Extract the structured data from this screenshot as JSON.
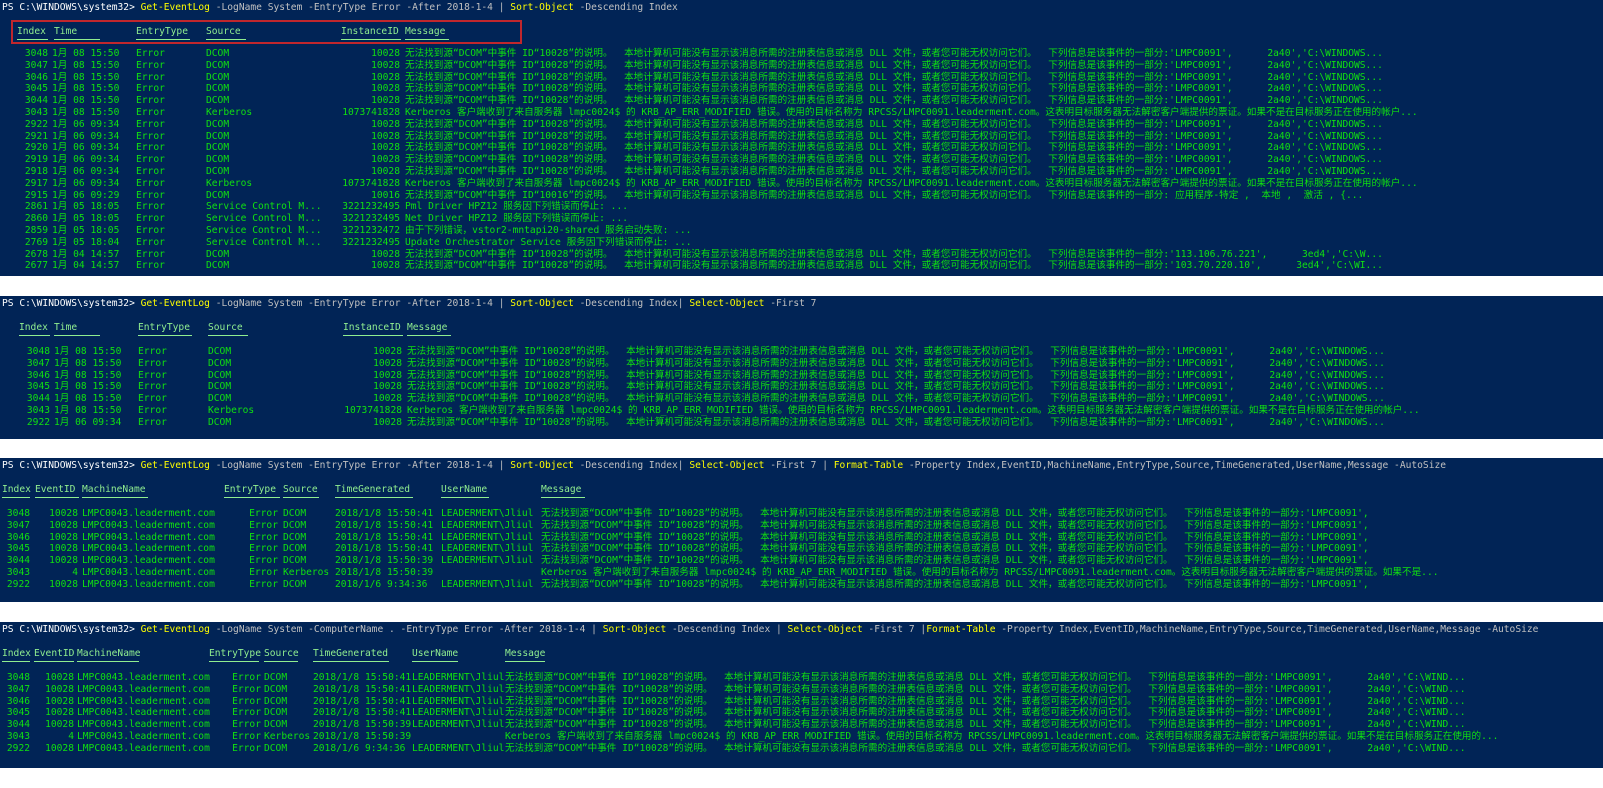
{
  "colors": {
    "background": "#012456",
    "prompt": "#ffffff",
    "cmdlet": "#ffff00",
    "parameter": "#c0c0c0",
    "output": "#10e010",
    "highlight": "#c0272d"
  },
  "panels": [
    {
      "command": [
        {
          "t": "PS C:\\WINDOWS\\system32> ",
          "c": "prompt"
        },
        {
          "t": "Get-EventLog",
          "c": "kw"
        },
        {
          "t": " -LogName System -EntryType Error -After 2018-1-4 | ",
          "c": "param"
        },
        {
          "t": "Sort-Object",
          "c": "kw"
        },
        {
          "t": " -Descending Index",
          "c": "param"
        }
      ],
      "headers": [
        "Index",
        "Time",
        "EntryType",
        "Source",
        "InstanceID",
        "Message"
      ],
      "rows": [
        [
          "3048",
          "1月 08 15:50",
          "Error",
          "DCOM",
          "10028",
          "无法找到源“DCOM”中事件 ID“10028”的说明。  本地计算机可能没有显示该消息所需的注册表信息或消息 DLL 文件，或者您可能无权访问它们。  下列信息是该事件的一部分:'LMPC0091',      2a40','C:\\WINDOWS..."
        ],
        [
          "3047",
          "1月 08 15:50",
          "Error",
          "DCOM",
          "10028",
          "无法找到源“DCOM”中事件 ID“10028”的说明。  本地计算机可能没有显示该消息所需的注册表信息或消息 DLL 文件，或者您可能无权访问它们。  下列信息是该事件的一部分:'LMPC0091',      2a40','C:\\WINDOWS..."
        ],
        [
          "3046",
          "1月 08 15:50",
          "Error",
          "DCOM",
          "10028",
          "无法找到源“DCOM”中事件 ID“10028”的说明。  本地计算机可能没有显示该消息所需的注册表信息或消息 DLL 文件，或者您可能无权访问它们。  下列信息是该事件的一部分:'LMPC0091',      2a40','C:\\WINDOWS..."
        ],
        [
          "3045",
          "1月 08 15:50",
          "Error",
          "DCOM",
          "10028",
          "无法找到源“DCOM”中事件 ID“10028”的说明。  本地计算机可能没有显示该消息所需的注册表信息或消息 DLL 文件，或者您可能无权访问它们。  下列信息是该事件的一部分:'LMPC0091',      2a40','C:\\WINDOWS..."
        ],
        [
          "3044",
          "1月 08 15:50",
          "Error",
          "DCOM",
          "10028",
          "无法找到源“DCOM”中事件 ID“10028”的说明。  本地计算机可能没有显示该消息所需的注册表信息或消息 DLL 文件，或者您可能无权访问它们。  下列信息是该事件的一部分:'LMPC0091',      2a40','C:\\WINDOWS..."
        ],
        [
          "3043",
          "1月 08 15:50",
          "Error",
          "Kerberos",
          "1073741828",
          "Kerberos 客户端收到了来自服务器 lmpc0024$ 的 KRB_AP_ERR_MODIFIED 错误。使用的目标名称为 RPCSS/LMPC0091.leaderment.com。这表明目标服务器无法解密客户端提供的票证。如果不是在目标服务正在使用的帐户..."
        ],
        [
          "2922",
          "1月 06 09:34",
          "Error",
          "DCOM",
          "10028",
          "无法找到源“DCOM”中事件 ID“10028”的说明。  本地计算机可能没有显示该消息所需的注册表信息或消息 DLL 文件，或者您可能无权访问它们。  下列信息是该事件的一部分:'LMPC0091',      2a40','C:\\WINDOWS..."
        ],
        [
          "2921",
          "1月 06 09:34",
          "Error",
          "DCOM",
          "10028",
          "无法找到源“DCOM”中事件 ID“10028”的说明。  本地计算机可能没有显示该消息所需的注册表信息或消息 DLL 文件，或者您可能无权访问它们。  下列信息是该事件的一部分:'LMPC0091',      2a40','C:\\WINDOWS..."
        ],
        [
          "2920",
          "1月 06 09:34",
          "Error",
          "DCOM",
          "10028",
          "无法找到源“DCOM”中事件 ID“10028”的说明。  本地计算机可能没有显示该消息所需的注册表信息或消息 DLL 文件，或者您可能无权访问它们。  下列信息是该事件的一部分:'LMPC0091',      2a40','C:\\WINDOWS..."
        ],
        [
          "2919",
          "1月 06 09:34",
          "Error",
          "DCOM",
          "10028",
          "无法找到源“DCOM”中事件 ID“10028”的说明。  本地计算机可能没有显示该消息所需的注册表信息或消息 DLL 文件，或者您可能无权访问它们。  下列信息是该事件的一部分:'LMPC0091',      2a40','C:\\WINDOWS..."
        ],
        [
          "2918",
          "1月 06 09:34",
          "Error",
          "DCOM",
          "10028",
          "无法找到源“DCOM”中事件 ID“10028”的说明。  本地计算机可能没有显示该消息所需的注册表信息或消息 DLL 文件，或者您可能无权访问它们。  下列信息是该事件的一部分:'LMPC0091',      2a40','C:\\WINDOWS..."
        ],
        [
          "2917",
          "1月 06 09:34",
          "Error",
          "Kerberos",
          "1073741828",
          "Kerberos 客户端收到了来自服务器 lmpc0024$ 的 KRB_AP_ERR_MODIFIED 错误。使用的目标名称为 RPCSS/LMPC0091.leaderment.com。这表明目标服务器无法解密客户端提供的票证。如果不是在目标服务正在使用的帐户..."
        ],
        [
          "2915",
          "1月 06 09:29",
          "Error",
          "DCOM",
          "10016",
          "无法找到源“DCOM”中事件 ID“10016”的说明。  本地计算机可能没有显示该消息所需的注册表信息或消息 DLL 文件，或者您可能无权访问它们。  下列信息是该事件的一部分: 应用程序-特定 ,  本地 ,  激活 , {..."
        ],
        [
          "2861",
          "1月 05 18:05",
          "Error",
          "Service Control M...",
          "3221232495",
          "Pml Driver HPZ12 服务因下列错误而停止: ..."
        ],
        [
          "2860",
          "1月 05 18:05",
          "Error",
          "Service Control M...",
          "3221232495",
          "Net Driver HPZ12 服务因下列错误而停止: ..."
        ],
        [
          "2859",
          "1月 05 18:05",
          "Error",
          "Service Control M...",
          "3221232472",
          "由于下列错误，vstor2-mntapi20-shared 服务启动失败: ..."
        ],
        [
          "2769",
          "1月 05 18:04",
          "Error",
          "Service Control M...",
          "3221232495",
          "Update Orchestrator Service 服务因下列错误而停止: ..."
        ],
        [
          "2678",
          "1月 04 14:57",
          "Error",
          "DCOM",
          "10028",
          "无法找到源“DCOM”中事件 ID“10028”的说明。  本地计算机可能没有显示该消息所需的注册表信息或消息 DLL 文件，或者您可能无权访问它们。  下列信息是该事件的一部分:'113.106.76.221',      3ed4','C:\\W..."
        ],
        [
          "2677",
          "1月 04 14:57",
          "Error",
          "DCOM",
          "10028",
          "无法找到源“DCOM”中事件 ID“10028”的说明。  本地计算机可能没有显示该消息所需的注册表信息或消息 DLL 文件，或者您可能无权访问它们。  下列信息是该事件的一部分:'103.70.220.10',      3ed4','C:\\WI..."
        ]
      ]
    },
    {
      "command": [
        {
          "t": "PS C:\\WINDOWS\\system32> ",
          "c": "prompt"
        },
        {
          "t": "Get-EventLog",
          "c": "kw"
        },
        {
          "t": " -LogName System -EntryType Error -After 2018-1-4 | ",
          "c": "param"
        },
        {
          "t": "Sort-Object",
          "c": "kw"
        },
        {
          "t": " -Descending Index| ",
          "c": "param"
        },
        {
          "t": "Select-Object",
          "c": "kw"
        },
        {
          "t": " -First 7",
          "c": "param"
        }
      ],
      "headers": [
        "Index",
        "Time",
        "EntryType",
        "Source",
        "InstanceID",
        "Message"
      ],
      "rows": [
        [
          "3048",
          "1月 08 15:50",
          "Error",
          "DCOM",
          "10028",
          "无法找到源“DCOM”中事件 ID“10028”的说明。  本地计算机可能没有显示该消息所需的注册表信息或消息 DLL 文件，或者您可能无权访问它们。  下列信息是该事件的一部分:'LMPC0091',      2a40','C:\\WINDOWS..."
        ],
        [
          "3047",
          "1月 08 15:50",
          "Error",
          "DCOM",
          "10028",
          "无法找到源“DCOM”中事件 ID“10028”的说明。  本地计算机可能没有显示该消息所需的注册表信息或消息 DLL 文件，或者您可能无权访问它们。  下列信息是该事件的一部分:'LMPC0091',      2a40','C:\\WINDOWS..."
        ],
        [
          "3046",
          "1月 08 15:50",
          "Error",
          "DCOM",
          "10028",
          "无法找到源“DCOM”中事件 ID“10028”的说明。  本地计算机可能没有显示该消息所需的注册表信息或消息 DLL 文件，或者您可能无权访问它们。  下列信息是该事件的一部分:'LMPC0091',      2a40','C:\\WINDOWS..."
        ],
        [
          "3045",
          "1月 08 15:50",
          "Error",
          "DCOM",
          "10028",
          "无法找到源“DCOM”中事件 ID“10028”的说明。  本地计算机可能没有显示该消息所需的注册表信息或消息 DLL 文件，或者您可能无权访问它们。  下列信息是该事件的一部分:'LMPC0091',      2a40','C:\\WINDOWS..."
        ],
        [
          "3044",
          "1月 08 15:50",
          "Error",
          "DCOM",
          "10028",
          "无法找到源“DCOM”中事件 ID“10028”的说明。  本地计算机可能没有显示该消息所需的注册表信息或消息 DLL 文件，或者您可能无权访问它们。  下列信息是该事件的一部分:'LMPC0091',      2a40','C:\\WINDOWS..."
        ],
        [
          "3043",
          "1月 08 15:50",
          "Error",
          "Kerberos",
          "1073741828",
          "Kerberos 客户端收到了来自服务器 lmpc0024$ 的 KRB_AP_ERR_MODIFIED 错误。使用的目标名称为 RPCSS/LMPC0091.leaderment.com。这表明目标服务器无法解密客户端提供的票证。如果不是在目标服务正在使用的帐户..."
        ],
        [
          "2922",
          "1月 06 09:34",
          "Error",
          "DCOM",
          "10028",
          "无法找到源“DCOM”中事件 ID“10028”的说明。  本地计算机可能没有显示该消息所需的注册表信息或消息 DLL 文件，或者您可能无权访问它们。  下列信息是该事件的一部分:'LMPC0091',      2a40','C:\\WINDOWS..."
        ]
      ]
    },
    {
      "command": [
        {
          "t": "PS C:\\WINDOWS\\system32> ",
          "c": "prompt"
        },
        {
          "t": "Get-EventLog",
          "c": "kw"
        },
        {
          "t": " -LogName System -EntryType Error -After 2018-1-4 | ",
          "c": "param"
        },
        {
          "t": "Sort-Object",
          "c": "kw"
        },
        {
          "t": " -Descending Index| ",
          "c": "param"
        },
        {
          "t": "Select-Object",
          "c": "kw"
        },
        {
          "t": " -First 7 | ",
          "c": "param"
        },
        {
          "t": "Format-Table",
          "c": "kw"
        },
        {
          "t": " -Property Index,EventID,MachineName,EntryType,Source,TimeGenerated,UserName,Message -AutoSize",
          "c": "param"
        }
      ],
      "headers": [
        "Index",
        "EventID",
        "MachineName",
        "EntryType",
        "Source",
        "TimeGenerated",
        "UserName",
        "Message"
      ],
      "rows": [
        [
          "3048",
          "10028",
          "LMPC0043.leaderment.com",
          "Error",
          "DCOM",
          "2018/1/8 15:50:41",
          "LEADERMENT\\Jliul",
          "无法找到源“DCOM”中事件 ID“10028”的说明。  本地计算机可能没有显示该消息所需的注册表信息或消息 DLL 文件，或者您可能无权访问它们。  下列信息是该事件的一部分:'LMPC0091',"
        ],
        [
          "3047",
          "10028",
          "LMPC0043.leaderment.com",
          "Error",
          "DCOM",
          "2018/1/8 15:50:41",
          "LEADERMENT\\Jliul",
          "无法找到源“DCOM”中事件 ID“10028”的说明。  本地计算机可能没有显示该消息所需的注册表信息或消息 DLL 文件，或者您可能无权访问它们。  下列信息是该事件的一部分:'LMPC0091',"
        ],
        [
          "3046",
          "10028",
          "LMPC0043.leaderment.com",
          "Error",
          "DCOM",
          "2018/1/8 15:50:41",
          "LEADERMENT\\Jliul",
          "无法找到源“DCOM”中事件 ID“10028”的说明。  本地计算机可能没有显示该消息所需的注册表信息或消息 DLL 文件，或者您可能无权访问它们。  下列信息是该事件的一部分:'LMPC0091',"
        ],
        [
          "3045",
          "10028",
          "LMPC0043.leaderment.com",
          "Error",
          "DCOM",
          "2018/1/8 15:50:41",
          "LEADERMENT\\Jliul",
          "无法找到源“DCOM”中事件 ID“10028”的说明。  本地计算机可能没有显示该消息所需的注册表信息或消息 DLL 文件，或者您可能无权访问它们。  下列信息是该事件的一部分:'LMPC0091',"
        ],
        [
          "3044",
          "10028",
          "LMPC0043.leaderment.com",
          "Error",
          "DCOM",
          "2018/1/8 15:50:39",
          "LEADERMENT\\Jliul",
          "无法找到源“DCOM”中事件 ID“10028”的说明。  本地计算机可能没有显示该消息所需的注册表信息或消息 DLL 文件，或者您可能无权访问它们。  下列信息是该事件的一部分:'LMPC0091',"
        ],
        [
          "3043",
          "4",
          "LMPC0043.leaderment.com",
          "Error",
          "Kerberos",
          "2018/1/8 15:50:39",
          "",
          "Kerberos 客户端收到了来自服务器 lmpc0024$ 的 KRB_AP_ERR_MODIFIED 错误。使用的目标名称为 RPCSS/LMPC0091.leaderment.com。这表明目标服务器无法解密客户端提供的票证。如果不是..."
        ],
        [
          "2922",
          "10028",
          "LMPC0043.leaderment.com",
          "Error",
          "DCOM",
          "2018/1/6 9:34:36",
          "LEADERMENT\\Jliul",
          "无法找到源“DCOM”中事件 ID“10028”的说明。  本地计算机可能没有显示该消息所需的注册表信息或消息 DLL 文件，或者您可能无权访问它们。  下列信息是该事件的一部分:'LMPC0091',"
        ]
      ]
    },
    {
      "command": [
        {
          "t": "PS C:\\WINDOWS\\system32> ",
          "c": "prompt"
        },
        {
          "t": "Get-EventLog",
          "c": "kw"
        },
        {
          "t": " -LogName System -ComputerName . -EntryType Error -After 2018-1-4 | ",
          "c": "param"
        },
        {
          "t": "Sort-Object",
          "c": "kw"
        },
        {
          "t": " -Descending Index | ",
          "c": "param"
        },
        {
          "t": "Select-Object",
          "c": "kw"
        },
        {
          "t": " -First 7 |",
          "c": "param"
        },
        {
          "t": "Format-Table",
          "c": "kw"
        },
        {
          "t": " -Property Index,EventID,MachineName,EntryType,Source,TimeGenerated,UserName,Message -AutoSize",
          "c": "param"
        }
      ],
      "headers": [
        "Index",
        "EventID",
        "MachineName",
        "EntryType",
        "Source",
        "TimeGenerated",
        "UserName",
        "Message"
      ],
      "rows": [
        [
          "3048",
          "10028",
          "LMPC0043.leaderment.com",
          "Error",
          "DCOM",
          "2018/1/8 15:50:41",
          "LEADERMENT\\Jliul",
          "无法找到源“DCOM”中事件 ID“10028”的说明。  本地计算机可能没有显示该消息所需的注册表信息或消息 DLL 文件，或者您可能无权访问它们。  下列信息是该事件的一部分:'LMPC0091',      2a40','C:\\WIND..."
        ],
        [
          "3047",
          "10028",
          "LMPC0043.leaderment.com",
          "Error",
          "DCOM",
          "2018/1/8 15:50:41",
          "LEADERMENT\\Jliul",
          "无法找到源“DCOM”中事件 ID“10028”的说明。  本地计算机可能没有显示该消息所需的注册表信息或消息 DLL 文件，或者您可能无权访问它们。  下列信息是该事件的一部分:'LMPC0091',      2a40','C:\\WIND..."
        ],
        [
          "3046",
          "10028",
          "LMPC0043.leaderment.com",
          "Error",
          "DCOM",
          "2018/1/8 15:50:41",
          "LEADERMENT\\Jliul",
          "无法找到源“DCOM”中事件 ID“10028”的说明。  本地计算机可能没有显示该消息所需的注册表信息或消息 DLL 文件，或者您可能无权访问它们。  下列信息是该事件的一部分:'LMPC0091',      2a40','C:\\WIND..."
        ],
        [
          "3045",
          "10028",
          "LMPC0043.leaderment.com",
          "Error",
          "DCOM",
          "2018/1/8 15:50:41",
          "LEADERMENT\\Jliul",
          "无法找到源“DCOM”中事件 ID“10028”的说明。  本地计算机可能没有显示该消息所需的注册表信息或消息 DLL 文件，或者您可能无权访问它们。  下列信息是该事件的一部分:'LMPC0091',      2a40','C:\\WIND..."
        ],
        [
          "3044",
          "10028",
          "LMPC0043.leaderment.com",
          "Error",
          "DCOM",
          "2018/1/8 15:50:39",
          "LEADERMENT\\Jliul",
          "无法找到源“DCOM”中事件 ID“10028”的说明。  本地计算机可能没有显示该消息所需的注册表信息或消息 DLL 文件，或者您可能无权访问它们。  下列信息是该事件的一部分:'LMPC0091',      2a40','C:\\WIND..."
        ],
        [
          "3043",
          "4",
          "LMPC0043.leaderment.com",
          "Error",
          "Kerberos",
          "2018/1/8 15:50:39",
          "",
          "Kerberos 客户端收到了来自服务器 lmpc0024$ 的 KRB_AP_ERR_MODIFIED 错误。使用的目标名称为 RPCSS/LMPC0091.leaderment.com。这表明目标服务器无法解密客户端提供的票证。如果不是在目标服务正在使用的..."
        ],
        [
          "2922",
          "10028",
          "LMPC0043.leaderment.com",
          "Error",
          "DCOM",
          "2018/1/6 9:34:36",
          "LEADERMENT\\Jliul",
          "无法找到源“DCOM”中事件 ID“10028”的说明。  本地计算机可能没有显示该消息所需的注册表信息或消息 DLL 文件，或者您可能无权访问它们。  下列信息是该事件的一部分:'LMPC0091',      2a40','C:\\WIND..."
        ]
      ]
    }
  ]
}
